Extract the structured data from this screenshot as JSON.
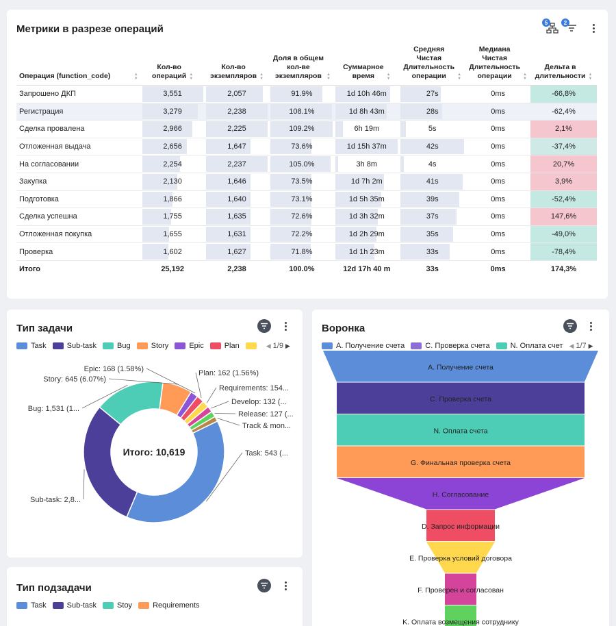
{
  "metrics": {
    "title": "Метрики в разрезе операций",
    "badges": {
      "hierarchy": "5",
      "sort": "2"
    },
    "headers": [
      [
        "Операция (function_code)"
      ],
      [
        "Кол-во",
        "операций"
      ],
      [
        "Кол-во",
        "экземпляров"
      ],
      [
        "Доля в общем",
        "кол-ве",
        "экземпляров"
      ],
      [
        "Суммарное",
        "время"
      ],
      [
        "Средняя",
        "Чистая",
        "Длительность",
        "операции"
      ],
      [
        "Медиана",
        "Чистая",
        "Длительность",
        "операции"
      ],
      [
        "Дельта в",
        "длительности"
      ]
    ],
    "rows": [
      {
        "name": "Запрошено ДКП",
        "ops": "3,551",
        "inst": "2,057",
        "share": "91.9%",
        "total": "1d 10h 46m",
        "avg": "27s",
        "median": "0ms",
        "delta": "-66,8%",
        "sign": "neg"
      },
      {
        "name": "Регистрация",
        "ops": "3,279",
        "inst": "2,238",
        "share": "108.1%",
        "total": "1d 8h 43m",
        "avg": "28s",
        "median": "0ms",
        "delta": "-62,4%",
        "sign": "neg"
      },
      {
        "name": "Сделка провалена",
        "ops": "2,966",
        "inst": "2,225",
        "share": "109.2%",
        "total": "6h 19m",
        "avg": "5s",
        "median": "0ms",
        "delta": "2,1%",
        "sign": "pos"
      },
      {
        "name": "Отложенная выдача",
        "ops": "2,656",
        "inst": "1,647",
        "share": "73.6%",
        "total": "1d 15h 37m",
        "avg": "42s",
        "median": "0ms",
        "delta": "-37,4%",
        "sign": "neu"
      },
      {
        "name": "На согласовании",
        "ops": "2,254",
        "inst": "2,237",
        "share": "105.0%",
        "total": "3h 8m",
        "avg": "4s",
        "median": "0ms",
        "delta": "20,7%",
        "sign": "pos"
      },
      {
        "name": "Закупка",
        "ops": "2,130",
        "inst": "1,646",
        "share": "73.5%",
        "total": "1d 7h 2m",
        "avg": "41s",
        "median": "0ms",
        "delta": "3,9%",
        "sign": "pos"
      },
      {
        "name": "Подготовка",
        "ops": "1,866",
        "inst": "1,640",
        "share": "73.1%",
        "total": "1d 5h 35m",
        "avg": "39s",
        "median": "0ms",
        "delta": "-52,4%",
        "sign": "neg"
      },
      {
        "name": "Сделка успешна",
        "ops": "1,755",
        "inst": "1,635",
        "share": "72.6%",
        "total": "1d 3h 32m",
        "avg": "37s",
        "median": "0ms",
        "delta": "147,6%",
        "sign": "pos"
      },
      {
        "name": "Отложенная покупка",
        "ops": "1,655",
        "inst": "1,631",
        "share": "72.2%",
        "total": "1d 2h 29m",
        "avg": "35s",
        "median": "0ms",
        "delta": "-49,0%",
        "sign": "neg"
      },
      {
        "name": "Проверка",
        "ops": "1,602",
        "inst": "1,627",
        "share": "71.8%",
        "total": "1d 1h 23m",
        "avg": "33s",
        "median": "0ms",
        "delta": "-78,4%",
        "sign": "neg"
      }
    ],
    "total_row": {
      "name": "Итого",
      "ops": "25,192",
      "inst": "2,238",
      "share": "100.0%",
      "total": "12d 17h 40 m",
      "avg": "33s",
      "median": "0ms",
      "delta": "174,3%"
    }
  },
  "task_type": {
    "title": "Тип задачи",
    "legend": [
      {
        "label": "Task",
        "color": "#5b8dd9"
      },
      {
        "label": "Sub-task",
        "color": "#4b3f9a"
      },
      {
        "label": "Bug",
        "color": "#4ecdb6"
      },
      {
        "label": "Story",
        "color": "#ff9b57"
      },
      {
        "label": "Epic",
        "color": "#8c55d6"
      },
      {
        "label": "Plan",
        "color": "#ee4d64"
      },
      {
        "label": "",
        "color": "#ffd84d"
      }
    ],
    "pager": "1/9",
    "center_label": "Итого: 10,619",
    "labels": [
      {
        "text": "Epic: 168 (1.58%)",
        "anchor": "end"
      },
      {
        "text": "Story: 645 (6.07%)",
        "anchor": "end"
      },
      {
        "text": "Bug: 1,531 (1...",
        "anchor": "end"
      },
      {
        "text": "Sub-task: 2,8...",
        "anchor": "end"
      },
      {
        "text": "Plan: 162 (1.56%)",
        "anchor": "start"
      },
      {
        "text": "Requirements: 154...",
        "anchor": "start"
      },
      {
        "text": "Develop: 132 (...",
        "anchor": "start"
      },
      {
        "text": "Release: 127 (...",
        "anchor": "start"
      },
      {
        "text": "Track & mon...",
        "anchor": "start"
      },
      {
        "text": "Task: 543 (...",
        "anchor": "start"
      }
    ]
  },
  "chart_data": {
    "type": "pie",
    "categories": [
      "Task",
      "Sub-task",
      "Bug",
      "Story",
      "Epic",
      "Plan",
      "Requirements",
      "Develop",
      "Release",
      "Track & mon..."
    ],
    "values": [
      3670,
      2820,
      1531,
      645,
      168,
      162,
      154,
      132,
      127,
      110
    ],
    "colors": [
      "#5b8dd9",
      "#4b3f9a",
      "#4ecdb6",
      "#ff9b57",
      "#8c55d6",
      "#ee4d64",
      "#ffd84d",
      "#d4449a",
      "#5fd15f",
      "#b8864a"
    ],
    "total": 10619
  },
  "funnel": {
    "title": "Воронка",
    "legend": [
      {
        "label": "А. Получение счета",
        "color": "#5b8dd9"
      },
      {
        "label": "С. Проверка счета",
        "color": "#8c6ed6"
      },
      {
        "label": "N. Оплата счет",
        "color": "#4ecdb6"
      }
    ],
    "pager": "1/7",
    "stages": [
      {
        "label": "А. Получение счета",
        "color": "#5b8dd9"
      },
      {
        "label": "С. Проверка счета",
        "color": "#4b3f9a"
      },
      {
        "label": "N. Оплата счета",
        "color": "#4ecdb6"
      },
      {
        "label": "G. Финальная проверка счета",
        "color": "#ff9b57"
      },
      {
        "label": "H. Согласование",
        "color": "#8c44d6"
      },
      {
        "label": "D. Запрос информации",
        "color": "#ee4d64"
      },
      {
        "label": "E. Проверка условий договора",
        "color": "#ffd84d"
      },
      {
        "label": "F. Проверен и согласован",
        "color": "#d4449a"
      },
      {
        "label": "K. Оплата возмещения сотруднику",
        "color": "#5fd15f"
      }
    ]
  },
  "subtask_type": {
    "title": "Тип подзадачи",
    "legend": [
      {
        "label": "Task",
        "color": "#5b8dd9"
      },
      {
        "label": "Sub-task",
        "color": "#4b3f9a"
      },
      {
        "label": "Stoy",
        "color": "#4ecdb6"
      },
      {
        "label": "Requirements",
        "color": "#ff9b57"
      }
    ]
  }
}
